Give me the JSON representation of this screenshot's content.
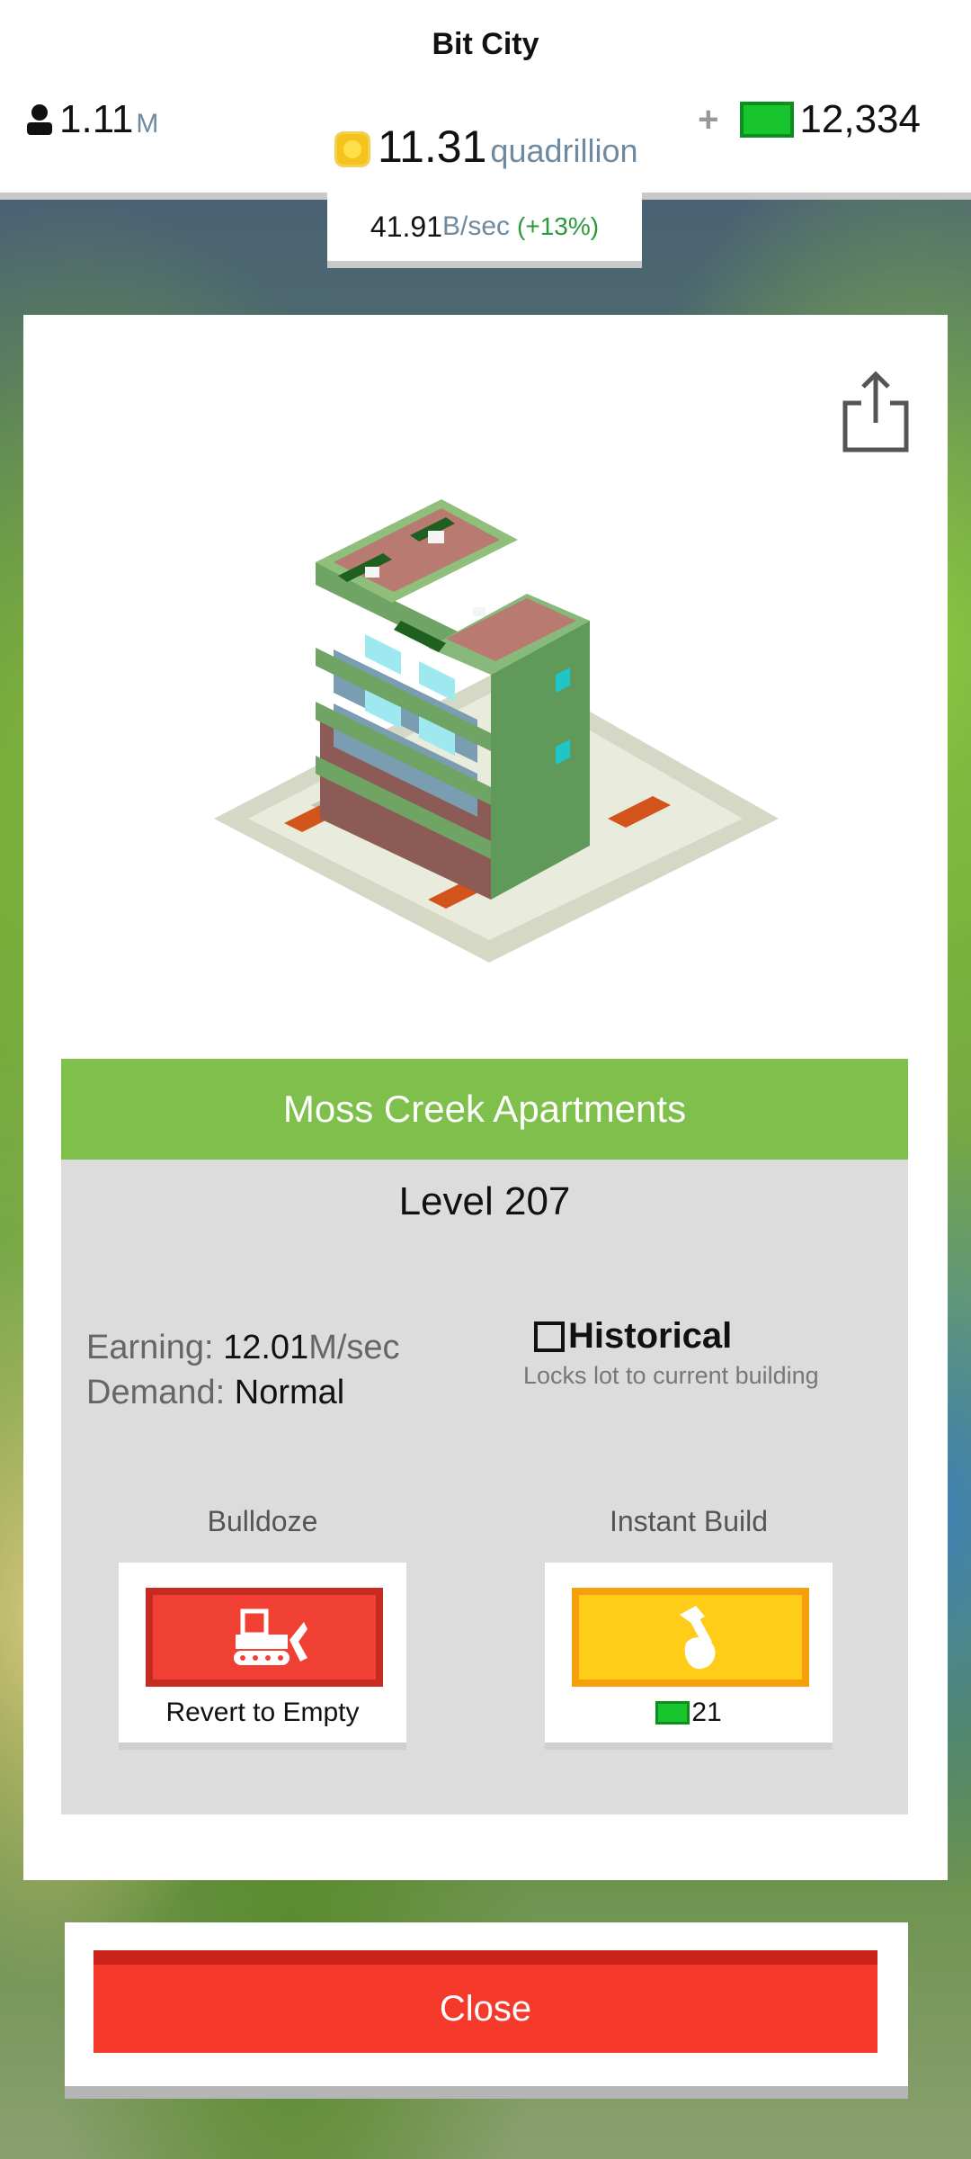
{
  "header": {
    "city_name": "Bit City",
    "population": {
      "value": "1.11",
      "unit": "M",
      "icon": "person-icon"
    },
    "coins": {
      "value": "11.31",
      "unit": "quadrillion",
      "icon": "coin-icon"
    },
    "bux": {
      "plus": "+",
      "value": "12,334",
      "icon": "green-bux-icon"
    },
    "income": {
      "value": "41.91",
      "unit": "B/sec",
      "change": "(+13%)"
    }
  },
  "building": {
    "name": "Moss Creek Apartments",
    "level": "Level 207",
    "earning_label": "Earning:",
    "earning_value": "12.01",
    "earning_unit": "M/sec",
    "demand_label": "Demand:",
    "demand_value": "Normal"
  },
  "historical": {
    "label": "Historical",
    "description": "Locks lot to current building",
    "checked": false
  },
  "actions": {
    "bulldoze": {
      "title": "Bulldoze",
      "caption": "Revert to Empty",
      "icon": "bulldozer-icon"
    },
    "instant_build": {
      "title": "Instant Build",
      "cost": "21",
      "icon": "hammer-icon"
    }
  },
  "close_label": "Close",
  "colors": {
    "accent_green": "#7ec04b",
    "close_red": "#f5392a",
    "bulldoze_red": "#f04034",
    "instant_yellow": "#ffcc17"
  }
}
